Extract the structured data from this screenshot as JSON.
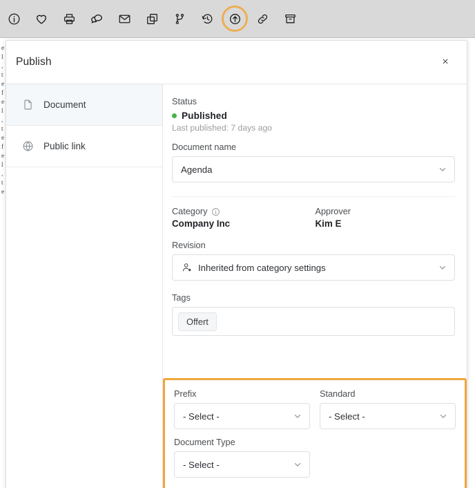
{
  "toolbar": {
    "items": [
      {
        "name": "info-icon",
        "label": "Information"
      },
      {
        "name": "heart-icon",
        "label": "Favorite"
      },
      {
        "name": "printer-icon",
        "label": "Print"
      },
      {
        "name": "comments-icon",
        "label": "Comments"
      },
      {
        "name": "envelope-icon",
        "label": "Send email"
      },
      {
        "name": "copy-icon",
        "label": "Duplicate"
      },
      {
        "name": "branch-icon",
        "label": "Branch"
      },
      {
        "name": "history-icon",
        "label": "History"
      },
      {
        "name": "publish-icon",
        "label": "Publish"
      },
      {
        "name": "link-icon",
        "label": "Link"
      },
      {
        "name": "archive-icon",
        "label": "Archive"
      }
    ],
    "highlighted": "publish-icon",
    "highlight_color": "#f0a63c",
    "background_color": "#d9d9d9"
  },
  "background_page": {
    "text": "e\nl\n,\nt\ne\nf\ne\nl\n,\nt\ne\nf\ne\nl\n,\nt\ne"
  },
  "modal": {
    "title": "Publish",
    "close_label": "×",
    "sidebar": {
      "items": [
        {
          "label": "Document",
          "icon": "document-icon",
          "active": true
        },
        {
          "label": "Public link",
          "icon": "globe-icon",
          "active": false
        }
      ]
    },
    "content": {
      "status": {
        "label": "Status",
        "value": "Published",
        "dot_color": "#45b549",
        "note": "Last published: 7 days ago"
      },
      "document_name": {
        "label": "Document name",
        "value": "Agenda"
      },
      "category": {
        "label": "Category",
        "value": "Company Inc",
        "has_info_icon": true
      },
      "approver": {
        "label": "Approver",
        "value": "Kim E"
      },
      "revision": {
        "label": "Revision",
        "value": "Inherited from category settings",
        "icon": "user-settings-icon"
      },
      "tags": {
        "label": "Tags",
        "chips": [
          "Offert"
        ]
      },
      "highlighted_section": {
        "border_color": "#f0a63c",
        "prefix": {
          "label": "Prefix",
          "value": "- Select -"
        },
        "standard": {
          "label": "Standard",
          "value": "- Select -"
        },
        "document_type": {
          "label": "Document Type",
          "value": "- Select -"
        }
      }
    }
  }
}
